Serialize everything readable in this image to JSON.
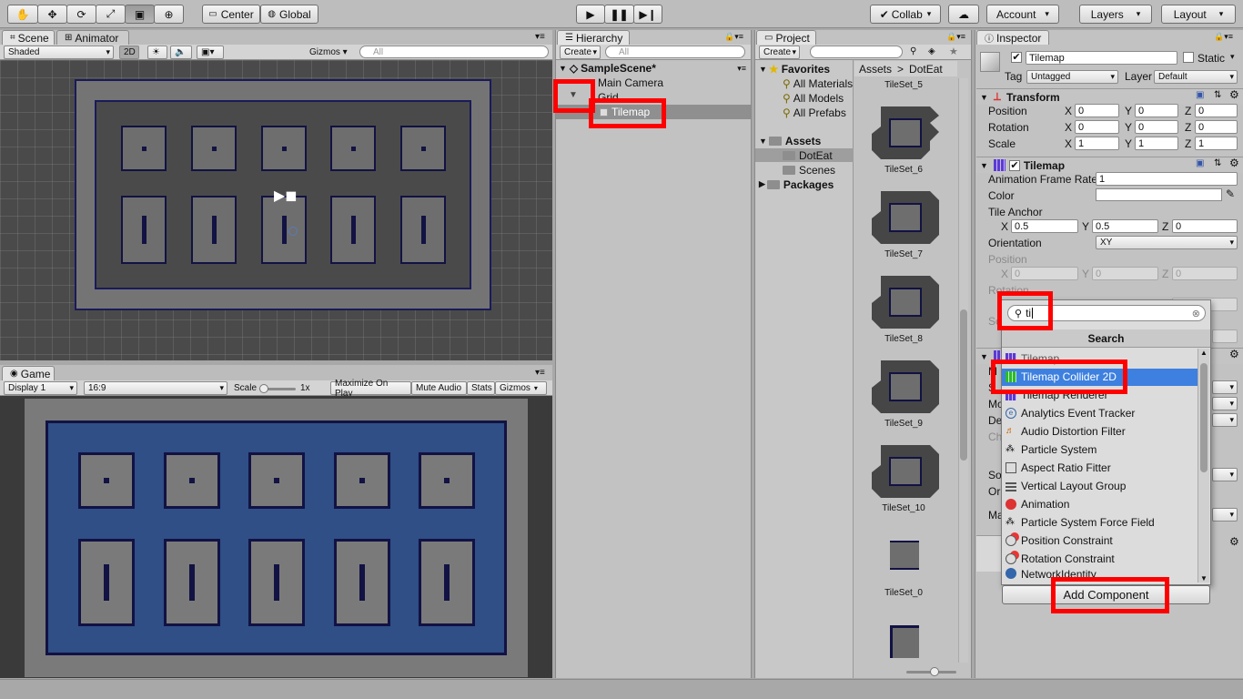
{
  "toolbar": {
    "pivot": "Center",
    "space": "Global",
    "collab": "Collab",
    "account": "Account",
    "layers": "Layers",
    "layout": "Layout"
  },
  "scene": {
    "tab_scene": "Scene",
    "tab_animator": "Animator",
    "shading": "Shaded",
    "mode_2d": "2D",
    "gizmos": "Gizmos",
    "search_placeholder": "All"
  },
  "game": {
    "tab": "Game",
    "display": "Display 1",
    "aspect": "16:9",
    "scale_label": "Scale",
    "scale_value": "1x",
    "maximize": "Maximize On Play",
    "mute": "Mute Audio",
    "stats": "Stats",
    "gizmos": "Gizmos"
  },
  "hierarchy": {
    "tab": "Hierarchy",
    "create": "Create",
    "search_placeholder": "All",
    "scene_name": "SampleScene*",
    "items": [
      "Main Camera",
      "Grid",
      "Tilemap"
    ]
  },
  "project": {
    "tab": "Project",
    "create": "Create",
    "favorites": "Favorites",
    "fav_items": [
      "All Materials",
      "All Models",
      "All Prefabs"
    ],
    "assets": "Assets",
    "asset_items": [
      "DotEat",
      "Scenes"
    ],
    "packages": "Packages",
    "breadcrumb_root": "Assets",
    "breadcrumb_sep": ">",
    "breadcrumb_current": "DotEat",
    "tilesets": [
      "TileSet_5",
      "TileSet_6",
      "TileSet_7",
      "TileSet_8",
      "TileSet_9",
      "TileSet_10",
      "TileSet_0"
    ]
  },
  "inspector": {
    "tab": "Inspector",
    "object_name": "Tilemap",
    "static_label": "Static",
    "tag_label": "Tag",
    "tag_value": "Untagged",
    "layer_label": "Layer",
    "layer_value": "Default",
    "transform": {
      "title": "Transform",
      "position_label": "Position",
      "rotation_label": "Rotation",
      "scale_label": "Scale",
      "x": "X",
      "y": "Y",
      "z": "Z",
      "position": [
        "0",
        "0",
        "0"
      ],
      "rotation": [
        "0",
        "0",
        "0"
      ],
      "scale": [
        "1",
        "1",
        "1"
      ]
    },
    "tilemap": {
      "title": "Tilemap",
      "frame_rate_label": "Animation Frame Rate",
      "frame_rate": "1",
      "color_label": "Color",
      "anchor_label": "Tile Anchor",
      "anchor": [
        "0.5",
        "0.5",
        "0"
      ],
      "orientation_label": "Orientation",
      "orientation": "XY",
      "position_label": "Position",
      "position": [
        "0",
        "0",
        "0"
      ],
      "rotation_label": "Rotation",
      "scale_label_partial": "Sc"
    },
    "partial_labels": [
      "M",
      "S",
      "Mo",
      "De",
      "Ch",
      "So",
      "Or",
      "Ma"
    ]
  },
  "add_component": {
    "search_value": "ti",
    "search_header": "Search",
    "items": [
      "Tilemap",
      "Tilemap Collider 2D",
      "Tilemap Renderer",
      "Analytics Event Tracker",
      "Audio Distortion Filter",
      "Particle System",
      "Aspect Ratio Fitter",
      "Vertical Layout Group",
      "Animation",
      "Particle System Force Field",
      "Position Constraint",
      "Rotation Constraint",
      "NetworkIdentity"
    ],
    "selected_index": 1,
    "button": "Add Component"
  },
  "colors": {
    "highlight_red": "#ff0000",
    "selection_blue": "#3d80df",
    "tile_outline": "#121244",
    "game_bg": "#2f4f86"
  }
}
